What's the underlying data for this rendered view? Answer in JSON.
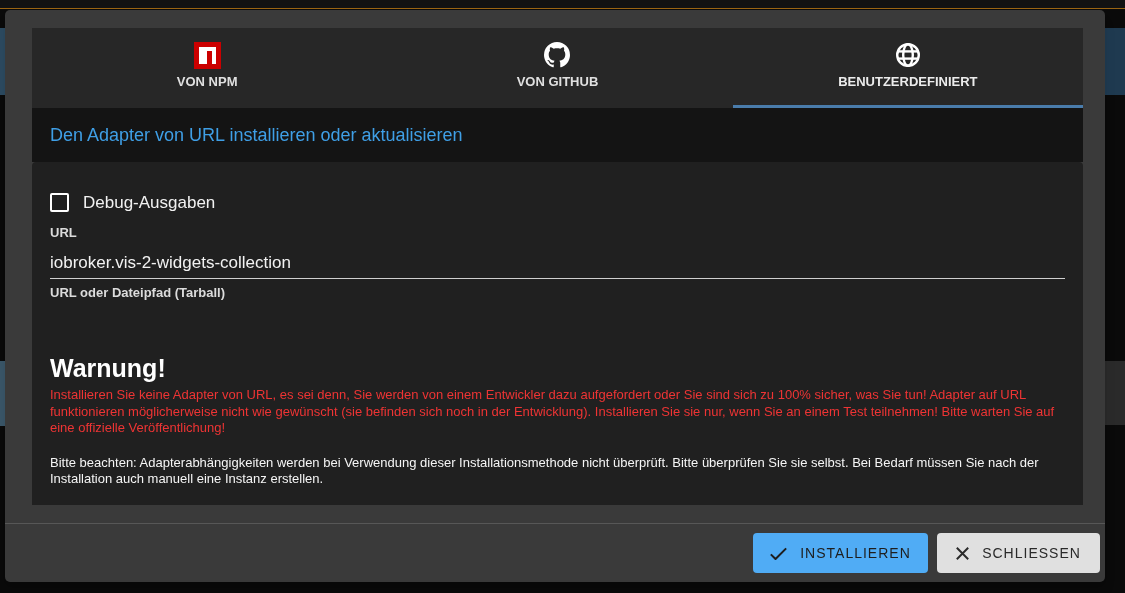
{
  "tabs": [
    {
      "label": "VON NPM",
      "kind": "npm",
      "selected": false
    },
    {
      "label": "VON GITHUB",
      "kind": "github",
      "selected": false
    },
    {
      "label": "BENUTZERDEFINIERT",
      "kind": "custom",
      "selected": true
    }
  ],
  "heading": "Den Adapter von URL installieren oder aktualisieren",
  "debug_option": {
    "label": "Debug-Ausgaben",
    "checked": false
  },
  "url_field": {
    "label": "URL",
    "value": "iobroker.vis-2-widgets-collection",
    "helper": "URL oder Dateipfad (Tarball)"
  },
  "warning": {
    "title": "Warnung!",
    "text": "Installieren Sie keine Adapter von URL, es sei denn, Sie werden von einem Entwickler dazu aufgefordert oder Sie sind sich zu 100% sicher, was Sie tun! Adapter auf URL funktionieren möglicherweise nicht wie gewünscht (sie befinden sich noch in der Entwicklung). Installieren Sie sie nur, wenn Sie an einem Test teilnehmen! Bitte warten Sie auf eine offizielle Veröffentlichung!",
    "note": "Bitte beachten: Adapterabhängigkeiten werden bei Verwendung dieser Installationsmethode nicht überprüft. Bitte überprüfen Sie sie selbst. Bei Bedarf müssen Sie nach der Installation auch manuell eine Instanz erstellen."
  },
  "buttons": [
    {
      "label": "INSTALLIEREN",
      "kind": "primary"
    },
    {
      "label": "SCHLIESSEN",
      "kind": "secondary"
    }
  ]
}
